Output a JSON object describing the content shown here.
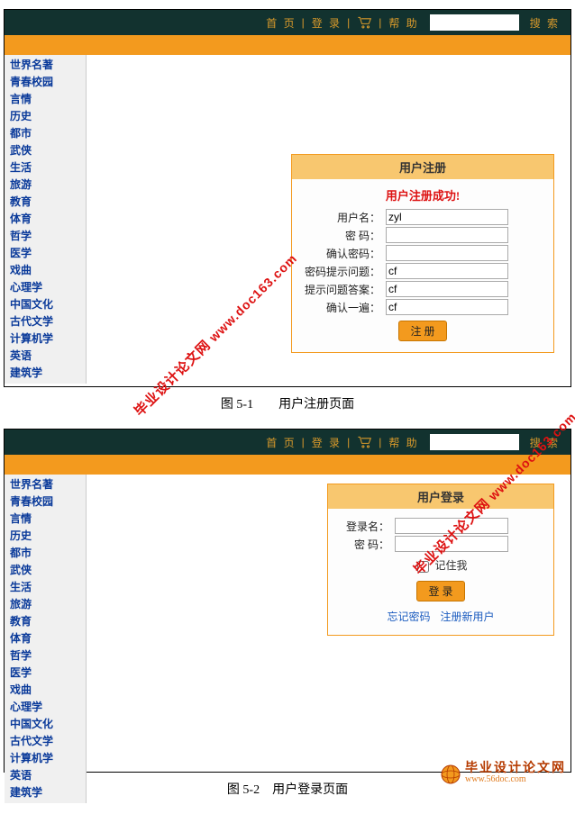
{
  "nav": {
    "home": "首 页",
    "login": "登 录",
    "help": "帮 助",
    "search_btn": "搜 索"
  },
  "sidebar": {
    "items": [
      {
        "label": "世界名著"
      },
      {
        "label": "青春校园"
      },
      {
        "label": "言情"
      },
      {
        "label": "历史"
      },
      {
        "label": "都市"
      },
      {
        "label": "武侠"
      },
      {
        "label": "生活"
      },
      {
        "label": "旅游"
      },
      {
        "label": "教育"
      },
      {
        "label": "体育"
      },
      {
        "label": "哲学"
      },
      {
        "label": "医学"
      },
      {
        "label": "戏曲"
      },
      {
        "label": "心理学"
      },
      {
        "label": "中国文化"
      },
      {
        "label": "古代文学"
      },
      {
        "label": "计算机学"
      },
      {
        "label": "英语"
      },
      {
        "label": "建筑学"
      }
    ]
  },
  "fig1": {
    "panel_title": "用户注册",
    "success": "用户注册成功!",
    "labels": {
      "username": "用户名：",
      "password": "密  码：",
      "confirm_password": "确认密码：",
      "hint_question": "密码提示问题：",
      "hint_answer": "提示问题答案：",
      "confirm_again": "确认一遍："
    },
    "values": {
      "username": "zyl",
      "password": "",
      "confirm_password": "",
      "hint_question": "cf",
      "hint_answer": "cf",
      "confirm_again": "cf"
    },
    "submit": "注 册",
    "caption": "图 5-1　　用户注册页面"
  },
  "fig2": {
    "panel_title": "用户登录",
    "labels": {
      "login_name": "登录名：",
      "password": "密  码："
    },
    "remember": "记住我",
    "submit": "登 录",
    "forgot": "忘记密码",
    "register_new": "注册新用户",
    "caption": "图 5-2　用户登录页面"
  },
  "watermark": {
    "prefix_cn": "毕业设计论文网",
    "url": "www.doc163.com"
  },
  "footer": {
    "title": "毕业设计论文网",
    "url": "www.56doc.com"
  }
}
